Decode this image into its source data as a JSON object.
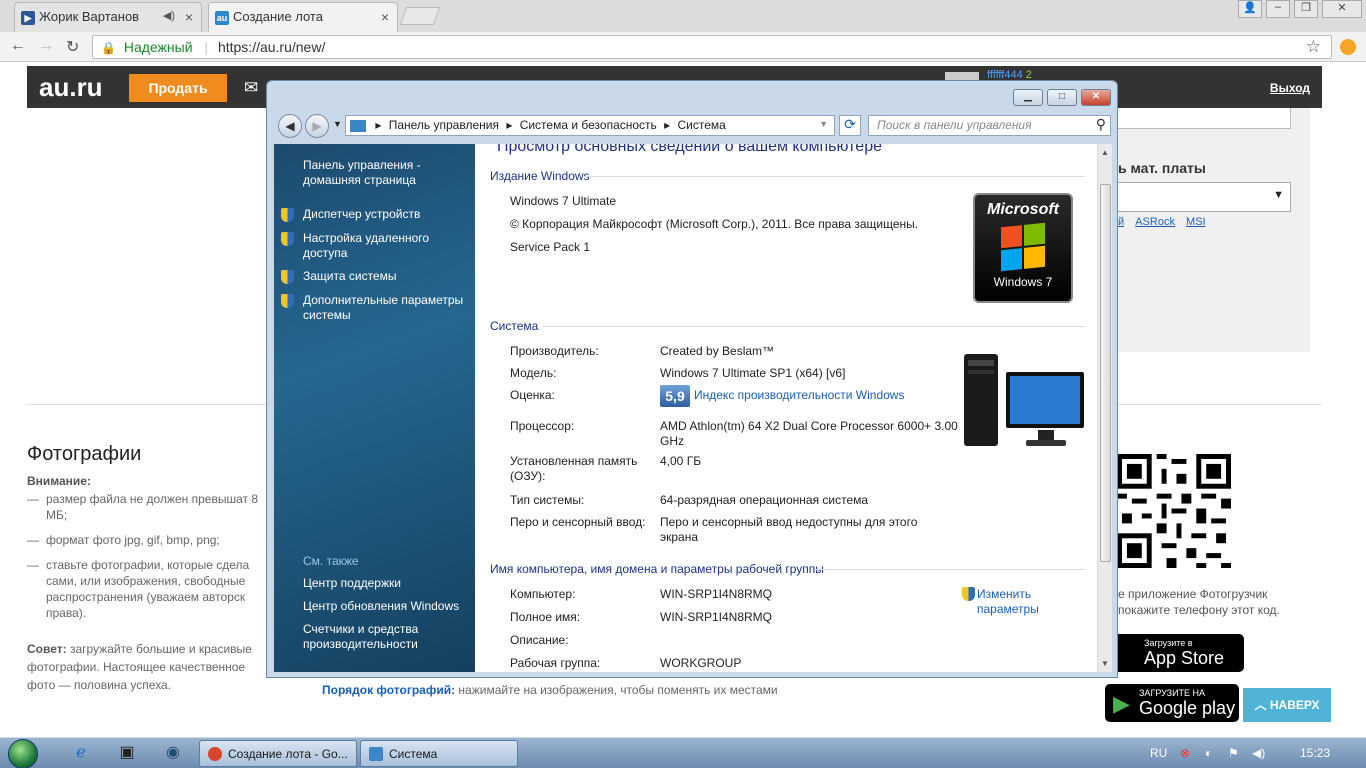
{
  "browser": {
    "tabs": [
      {
        "label": "Жорик Вартанов",
        "icon_color": "#2b5797",
        "icon_text": "▶",
        "muted": true
      },
      {
        "label": "Создание лота",
        "icon_color": "#2c86c9",
        "icon_text": "au",
        "muted": false
      }
    ],
    "secure_label": "Надежный",
    "url": "https://au.ru/new/"
  },
  "site": {
    "logo": "au.ru",
    "sell_button": "Продать",
    "username": "ffffff444",
    "username_count": "2",
    "logout": "Выход",
    "motherboard_label": "ь мат. платы",
    "motherboard_links": [
      "й",
      "ASRock",
      "MSI"
    ],
    "photos_title": "Фотографии",
    "attention": "Внимание:",
    "bullets": [
      "размер файла не должен превышат 8 МБ;",
      "формат фото jpg, gif, bmp, png;",
      "ставьте фотографии, которые сдела сами, или изображения, свободные распространения (уважаем авторск права)."
    ],
    "tip_label": "Совет:",
    "tip_text": " загружайте большие и красивые фотографии. Настоящее качественное фото — половина успеха.",
    "order_label": "Порядок фотографий:",
    "order_text": " нажимайте на изображения, чтобы поменять их местами",
    "qr_text": "е приложение Фотогрузчик покажите телефону этот код.",
    "appstore_small": "Загрузите в",
    "appstore_big": "App Store",
    "gplay_small": "ЗАГРУЗИТЕ НА",
    "gplay_big": "Google play",
    "naverh": "НАВЕРХ"
  },
  "dialog": {
    "breadcrumbs": [
      "Панель управления",
      "Система и безопасность",
      "Система"
    ],
    "search_placeholder": "Поиск в панели управления",
    "left": {
      "home": "Панель управления - домашняя страница",
      "items": [
        "Диспетчер устройств",
        "Настройка удаленного доступа",
        "Защита системы",
        "Дополнительные параметры системы"
      ],
      "see_also": "См. также",
      "see_items": [
        "Центр поддержки",
        "Центр обновления Windows",
        "Счетчики и средства производительности"
      ]
    },
    "heading": "Просмотр основных сведений о вашем компьютере",
    "edition_title": "Издание Windows",
    "edition": "Windows 7 Ultimate",
    "copyright": "© Корпорация Майкрософт (Microsoft Corp.), 2011. Все права защищены.",
    "service_pack": "Service Pack 1",
    "ms_logo_top": "Microsoft",
    "ms_logo_bottom": "Windows 7",
    "system_title": "Система",
    "rows": [
      {
        "label": "Производитель:",
        "value": "Created by Beslam™"
      },
      {
        "label": "Модель:",
        "value": "Windows 7 Ultimate SP1 (x64) [v6]"
      },
      {
        "label": "Оценка:",
        "value": "Индекс производительности Windows"
      },
      {
        "label": "Процессор:",
        "value": "AMD Athlon(tm) 64 X2 Dual Core Processor 6000+   3.00 GHz"
      },
      {
        "label": "Установленная память (ОЗУ):",
        "value": "4,00 ГБ"
      },
      {
        "label": "Тип системы:",
        "value": "64-разрядная операционная система"
      },
      {
        "label": "Перо и сенсорный ввод:",
        "value": "Перо и сенсорный ввод недоступны для этого экрана"
      }
    ],
    "rating": "5,9",
    "name_title": "Имя компьютера, имя домена и параметры рабочей группы",
    "change_link": "Изменить параметры",
    "name_rows": [
      {
        "label": "Компьютер:",
        "value": "WIN-SRP1I4N8RMQ"
      },
      {
        "label": "Полное имя:",
        "value": "WIN-SRP1I4N8RMQ"
      },
      {
        "label": "Описание:",
        "value": ""
      },
      {
        "label": "Рабочая группа:",
        "value": "WORKGROUP"
      }
    ]
  },
  "taskbar": {
    "tasks": [
      {
        "label": "Создание лота - Go...",
        "color": "#d9442c"
      },
      {
        "label": "Система",
        "color": "#3a86c8"
      }
    ],
    "lang": "RU",
    "time": "15:23"
  }
}
